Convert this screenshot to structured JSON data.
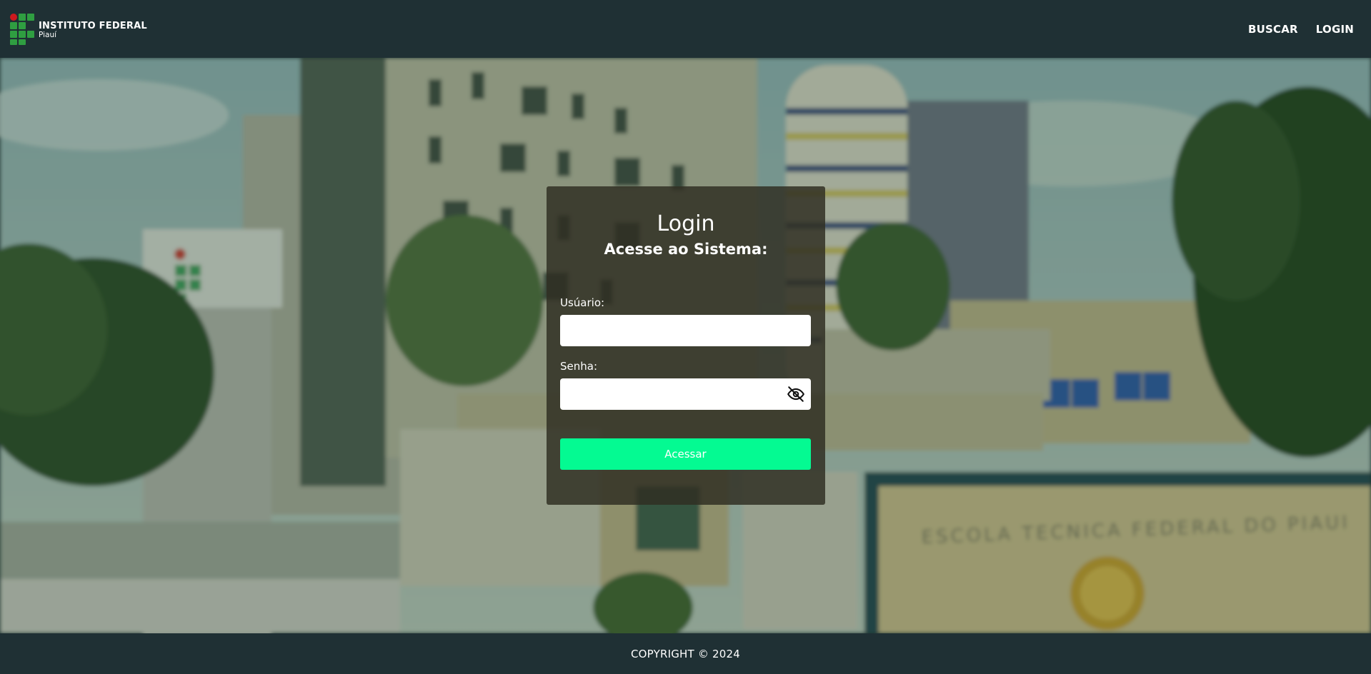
{
  "header": {
    "logo": {
      "title": "INSTITUTO FEDERAL",
      "subtitle": "Piauí"
    },
    "nav": [
      {
        "label": "BUSCAR"
      },
      {
        "label": "LOGIN"
      }
    ]
  },
  "login": {
    "title": "Login",
    "subtitle": "Acesse ao Sistema:",
    "username": {
      "label": "Usúario:",
      "value": "",
      "placeholder": ""
    },
    "password": {
      "label": "Senha:",
      "value": "",
      "placeholder": "",
      "toggle_icon": "eye-off-icon"
    },
    "submit_label": "Acessar"
  },
  "background": {
    "sign_text": "ESCOLA TECNICA FEDERAL DO PIAUI"
  },
  "footer": {
    "copyright": "COPYRIGHT © 2024"
  },
  "colors": {
    "bar_bg": "#1f3034",
    "accent": "#04fa92",
    "logo_green": "#2f9e41",
    "logo_red": "#cd191e"
  }
}
